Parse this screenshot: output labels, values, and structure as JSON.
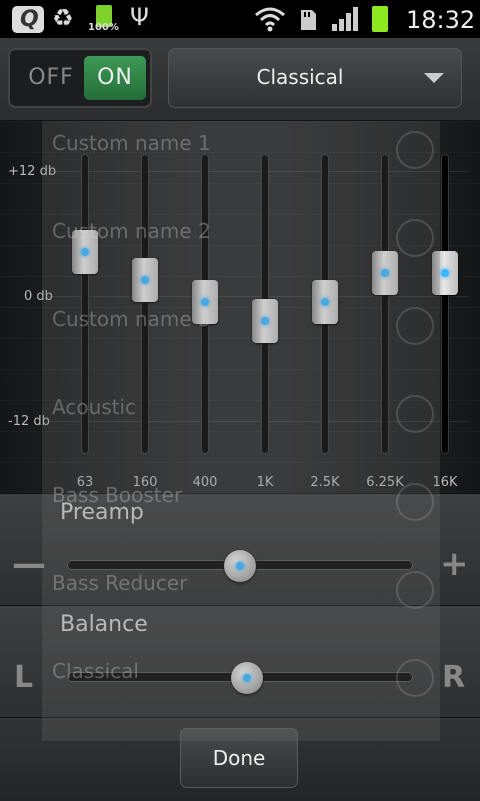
{
  "status_bar": {
    "battery_small_text": "100%",
    "time": "18:32",
    "icons": [
      "app-icon",
      "recycle-icon",
      "battery-icon",
      "usb-icon",
      "wifi-icon",
      "sd-card-icon",
      "signal-icon",
      "battery-icon"
    ]
  },
  "header": {
    "toggle_off_label": "OFF",
    "toggle_on_label": "ON",
    "toggle_state": "on",
    "preset_selected": "Classical"
  },
  "eq": {
    "db_labels": [
      "+12 db",
      "0 db",
      "-12 db"
    ],
    "range_db": [
      -12,
      12
    ],
    "bands": [
      {
        "label": "63",
        "gain_db": 4.2
      },
      {
        "label": "160",
        "gain_db": 1.5
      },
      {
        "label": "400",
        "gain_db": -0.6
      },
      {
        "label": "1K",
        "gain_db": -2.4
      },
      {
        "label": "2.5K",
        "gain_db": -0.6
      },
      {
        "label": "6.25K",
        "gain_db": 2.2
      },
      {
        "label": "16K",
        "gain_db": 2.2
      }
    ]
  },
  "preamp": {
    "title": "Preamp",
    "minus": "—",
    "plus": "+",
    "value": 0.5
  },
  "balance": {
    "title": "Balance",
    "left": "L",
    "right": "R",
    "value": 0.52
  },
  "footer": {
    "done_label": "Done"
  },
  "overlay_presets": [
    "Custom name 1",
    "Custom name 2",
    "Custom name 3",
    "Acoustic",
    "Bass Booster",
    "Bass Reducer",
    "Classical"
  ],
  "colors": {
    "accent_green": "#2f8a47",
    "knob_dot": "#3bb8ff",
    "battery": "#8ee820"
  }
}
